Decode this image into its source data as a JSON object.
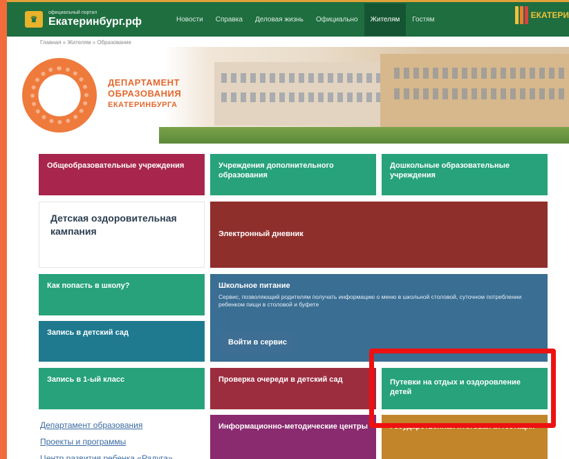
{
  "header": {
    "logo_small": "официальный портал",
    "logo_main": "Екатеринбург.рф",
    "nav": [
      "Новости",
      "Справка",
      "Деловая жизнь",
      "Официально",
      "Жителям",
      "Гостям"
    ],
    "brand_right": "ЕКАТЕРИ"
  },
  "breadcrumb": "Главная » Жителям » Образование",
  "hero": {
    "title_lines": [
      "ДЕПАРТАМЕНТ",
      "ОБРАЗОВАНИЯ",
      "ЕКАТЕРИНБУРГА"
    ]
  },
  "tiles": {
    "general_schools": "Общеобразовательные учреждения",
    "additional_edu": "Учреждения дополнительного образования",
    "preschool": "Дошкольные образовательные учреждения",
    "health_campaign": "Детская оздоровительная кампания",
    "e_diary": "Электронный дневник",
    "how_to_school": "Как попасть в школу?",
    "school_food_title": "Школьное питание",
    "school_food_desc": "Сервис, позволяющий родителям получать информацию о меню в школьной столовой, суточном потреблении ребенком пищи в столовой и буфете",
    "school_food_button": "Войти в сервис",
    "kindergarten_signup": "Запись в детский сад",
    "first_grade_signup": "Запись в 1-ый класс",
    "queue_check": "Проверка очереди в детский сад",
    "vouchers": "Путевки на отдых и оздоровление детей",
    "info_centers": "Информационно-методические центры",
    "state_attestation": "Государственная итоговая аттестация"
  },
  "side_links": [
    "Департамент образования",
    "Проекты и программы",
    "Центр развития ребенка «Радуга»"
  ],
  "colors": {
    "nav_green": "#1f6e40",
    "crimson": "#a8264e",
    "green": "#27a27a",
    "brick": "#8f2f2c",
    "blue": "#3a6e93",
    "teal": "#1f7a90",
    "dark_red": "#9c2d3f",
    "purple": "#8a2a6f",
    "amber": "#c2852a",
    "highlight_red": "#ee1111"
  }
}
